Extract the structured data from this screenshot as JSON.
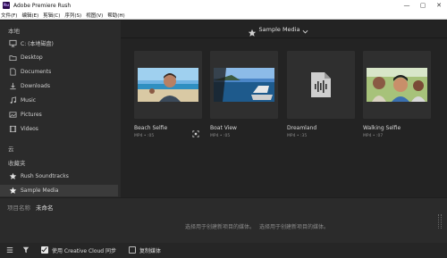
{
  "window": {
    "title": "Adobe Premiere Rush",
    "logo_text": "Ru",
    "controls": [
      "—",
      "▢",
      "✕"
    ]
  },
  "menu": [
    "文件(F)",
    "编辑(E)",
    "剪辑(C)",
    "序列(S)",
    "视图(V)",
    "帮助(H)"
  ],
  "sidebar": {
    "local_label": "本地",
    "local_items": [
      {
        "label": "C: (本地磁盘)",
        "icon": "monitor-icon"
      },
      {
        "label": "Desktop",
        "icon": "folder-icon"
      },
      {
        "label": "Documents",
        "icon": "document-icon"
      },
      {
        "label": "Downloads",
        "icon": "download-icon"
      },
      {
        "label": "Music",
        "icon": "music-icon"
      },
      {
        "label": "Pictures",
        "icon": "image-icon"
      },
      {
        "label": "Videos",
        "icon": "video-icon"
      }
    ],
    "cloud_label": "云",
    "favorites_label": "收藏夹",
    "favorite_items": [
      {
        "label": "Rush Soundtracks",
        "icon": "star-icon"
      },
      {
        "label": "Sample Media",
        "icon": "star-icon",
        "selected": true
      }
    ]
  },
  "main": {
    "header_title": "Sample Media",
    "media": [
      {
        "name": "Beach Selfie",
        "meta": "MP4 • :05",
        "icon": "selfie-photo",
        "selected": true
      },
      {
        "name": "Boat View",
        "meta": "MP4 • :05",
        "icon": "boat-photo"
      },
      {
        "name": "Dreamland",
        "meta": "MP4 • :35",
        "icon": "audio-file-icon"
      },
      {
        "name": "Walking Selfie",
        "meta": "MP4 • :07",
        "icon": "walking-photo"
      }
    ]
  },
  "bottom": {
    "project_name_label": "项目名称",
    "project_name_value": "未命名",
    "hint_left": "选择用于创建新项目的媒体。",
    "hint_right": "选择用于创建新项目的媒体。"
  },
  "footer": {
    "sync_label": "使用 Creative Cloud 同步",
    "sync_checked": true,
    "copy_label": "复制媒体",
    "copy_checked": false
  },
  "colors": {
    "background": "#1d1d1d",
    "sidebar": "#2b2b2b",
    "selected": "#3b3b3b",
    "text": "#d8d8d8",
    "muted": "#8a8a8a"
  }
}
